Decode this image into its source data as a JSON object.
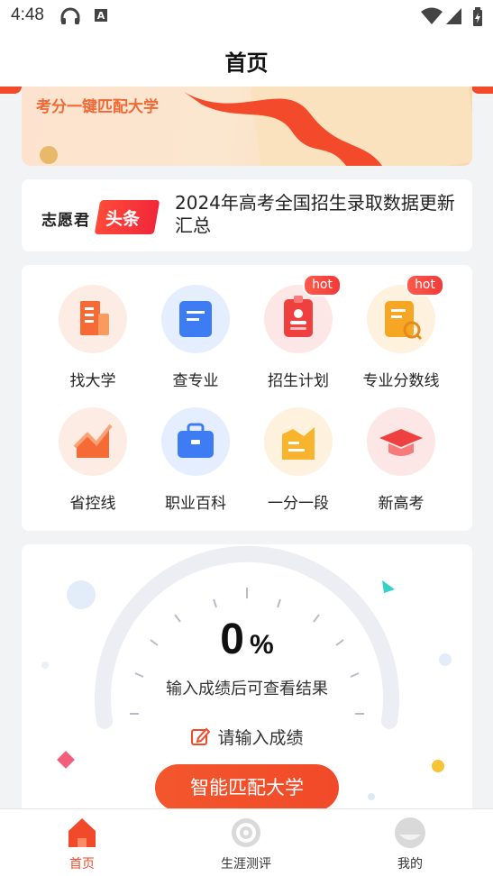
{
  "status_bar": {
    "time": "4:48"
  },
  "header": {
    "title": "首页"
  },
  "banner": {
    "text": "考分一键匹配大学"
  },
  "news": {
    "logo": "志愿君",
    "tag": "头条",
    "headline": "2024年高考全国招生录取数据更新汇总"
  },
  "features": [
    {
      "label": "找大学",
      "icon": "building-icon",
      "hot": false
    },
    {
      "label": "查专业",
      "icon": "document-icon",
      "hot": false
    },
    {
      "label": "招生计划",
      "icon": "badge-card-icon",
      "hot": true
    },
    {
      "label": "专业分数线",
      "icon": "clipboard-search-icon",
      "hot": true
    },
    {
      "label": "省控线",
      "icon": "trend-chart-icon",
      "hot": false
    },
    {
      "label": "职业百科",
      "icon": "briefcase-icon",
      "hot": false
    },
    {
      "label": "一分一段",
      "icon": "bar-chart-icon",
      "hot": false
    },
    {
      "label": "新高考",
      "icon": "graduation-cap-icon",
      "hot": false
    }
  ],
  "hot_label": "hot",
  "score": {
    "percent": "0",
    "percent_sign": "%",
    "hint": "输入成绩后可查看结果",
    "enter_label": "请输入成绩",
    "button_label": "智能匹配大学"
  },
  "tabs": [
    {
      "label": "首页",
      "icon": "home-icon",
      "active": true
    },
    {
      "label": "生涯测评",
      "icon": "target-icon",
      "active": false
    },
    {
      "label": "我的",
      "icon": "profile-icon",
      "active": false
    }
  ],
  "colors": {
    "accent": "#f14a2a",
    "gauge": "#eceef3"
  }
}
